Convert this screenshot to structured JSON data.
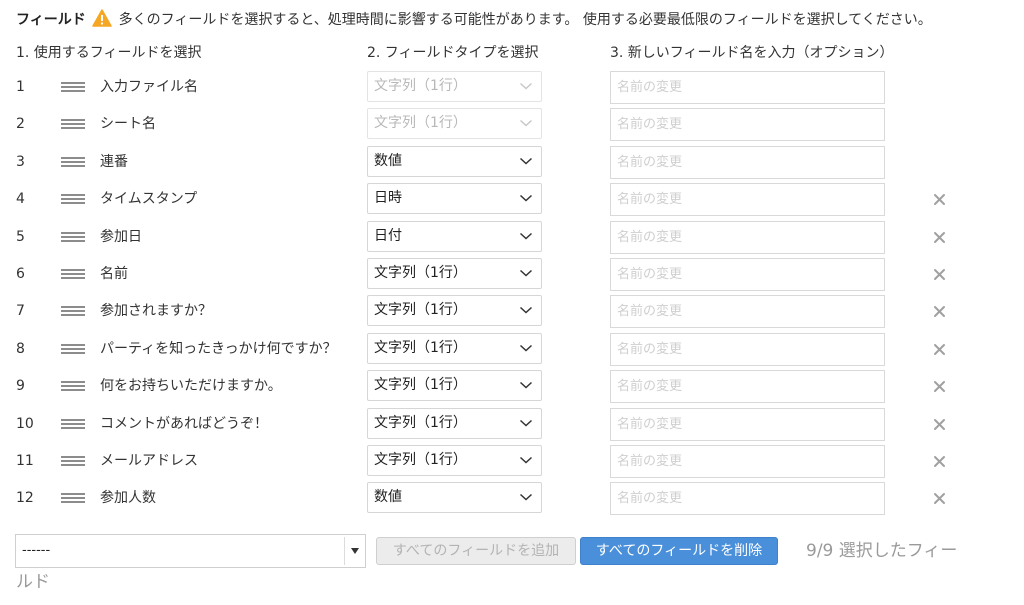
{
  "notice": {
    "title": "フィールド",
    "icon": "warning-icon",
    "icon_color": "#f5a623",
    "text": "多くのフィールドを選択すると、処理時間に影響する可能性があります。 使用する必要最低限のフィールドを選択してください。"
  },
  "headers": {
    "col1": "1. 使用するフィールドを選択",
    "col2": "2. フィールドタイプを選択",
    "col3": "3. 新しいフィールド名を入力（オプション）"
  },
  "rename_placeholder": "名前の変更",
  "rows": [
    {
      "num": "1",
      "name": "入力ファイル名",
      "type": "文字列（1行）",
      "disabled": true,
      "removable": false
    },
    {
      "num": "2",
      "name": "シート名",
      "type": "文字列（1行）",
      "disabled": true,
      "removable": false
    },
    {
      "num": "3",
      "name": "連番",
      "type": "数値",
      "disabled": false,
      "removable": false
    },
    {
      "num": "4",
      "name": "タイムスタンプ",
      "type": "日時",
      "disabled": false,
      "removable": true
    },
    {
      "num": "5",
      "name": "参加日",
      "type": "日付",
      "disabled": false,
      "removable": true
    },
    {
      "num": "6",
      "name": "名前",
      "type": "文字列（1行）",
      "disabled": false,
      "removable": true
    },
    {
      "num": "7",
      "name": "参加されますか？",
      "type": "文字列（1行）",
      "disabled": false,
      "removable": true
    },
    {
      "num": "8",
      "name": "パーティを知ったきっかけ何ですか？",
      "type": "文字列（1行）",
      "disabled": false,
      "removable": true
    },
    {
      "num": "9",
      "name": "何をお持ちいただけますか。",
      "type": "文字列（1行）",
      "disabled": false,
      "removable": true
    },
    {
      "num": "10",
      "name": "コメントがあればどうぞ！",
      "type": "文字列（1行）",
      "disabled": false,
      "removable": true
    },
    {
      "num": "11",
      "name": "メールアドレス",
      "type": "文字列（1行）",
      "disabled": false,
      "removable": true
    },
    {
      "num": "12",
      "name": "参加人数",
      "type": "数値",
      "disabled": false,
      "removable": true
    }
  ],
  "footer": {
    "select_value": "------",
    "add_all_label": "すべてのフィールドを追加",
    "remove_all_label": "すべてのフィールドを削除",
    "count_text_line1": "9/9 選択したフィー",
    "count_text_line2": "ルド"
  },
  "colors": {
    "primary_button": "#4a8fd9",
    "warning": "#f5a623"
  }
}
